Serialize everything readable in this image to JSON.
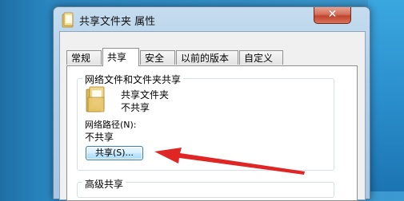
{
  "window": {
    "title": "共享文件夹 属性",
    "close_label": "✕"
  },
  "tabs": [
    "常规",
    "共享",
    "安全",
    "以前的版本",
    "自定义"
  ],
  "active_tab": 1,
  "network_group": {
    "label": "网络文件和文件夹共享",
    "folder_name": "共享文件夹",
    "folder_status": "不共享",
    "path_label": "网络路径(N):",
    "path_value": "不共享",
    "share_button": "共享(S)..."
  },
  "advanced_group": {
    "label": "高级共享"
  },
  "colors": {
    "arrow": "#e02525",
    "accent": "#3c7fb1"
  },
  "icons": {
    "title": "folder-icon",
    "folder": "folder-icon",
    "close": "close-icon"
  }
}
